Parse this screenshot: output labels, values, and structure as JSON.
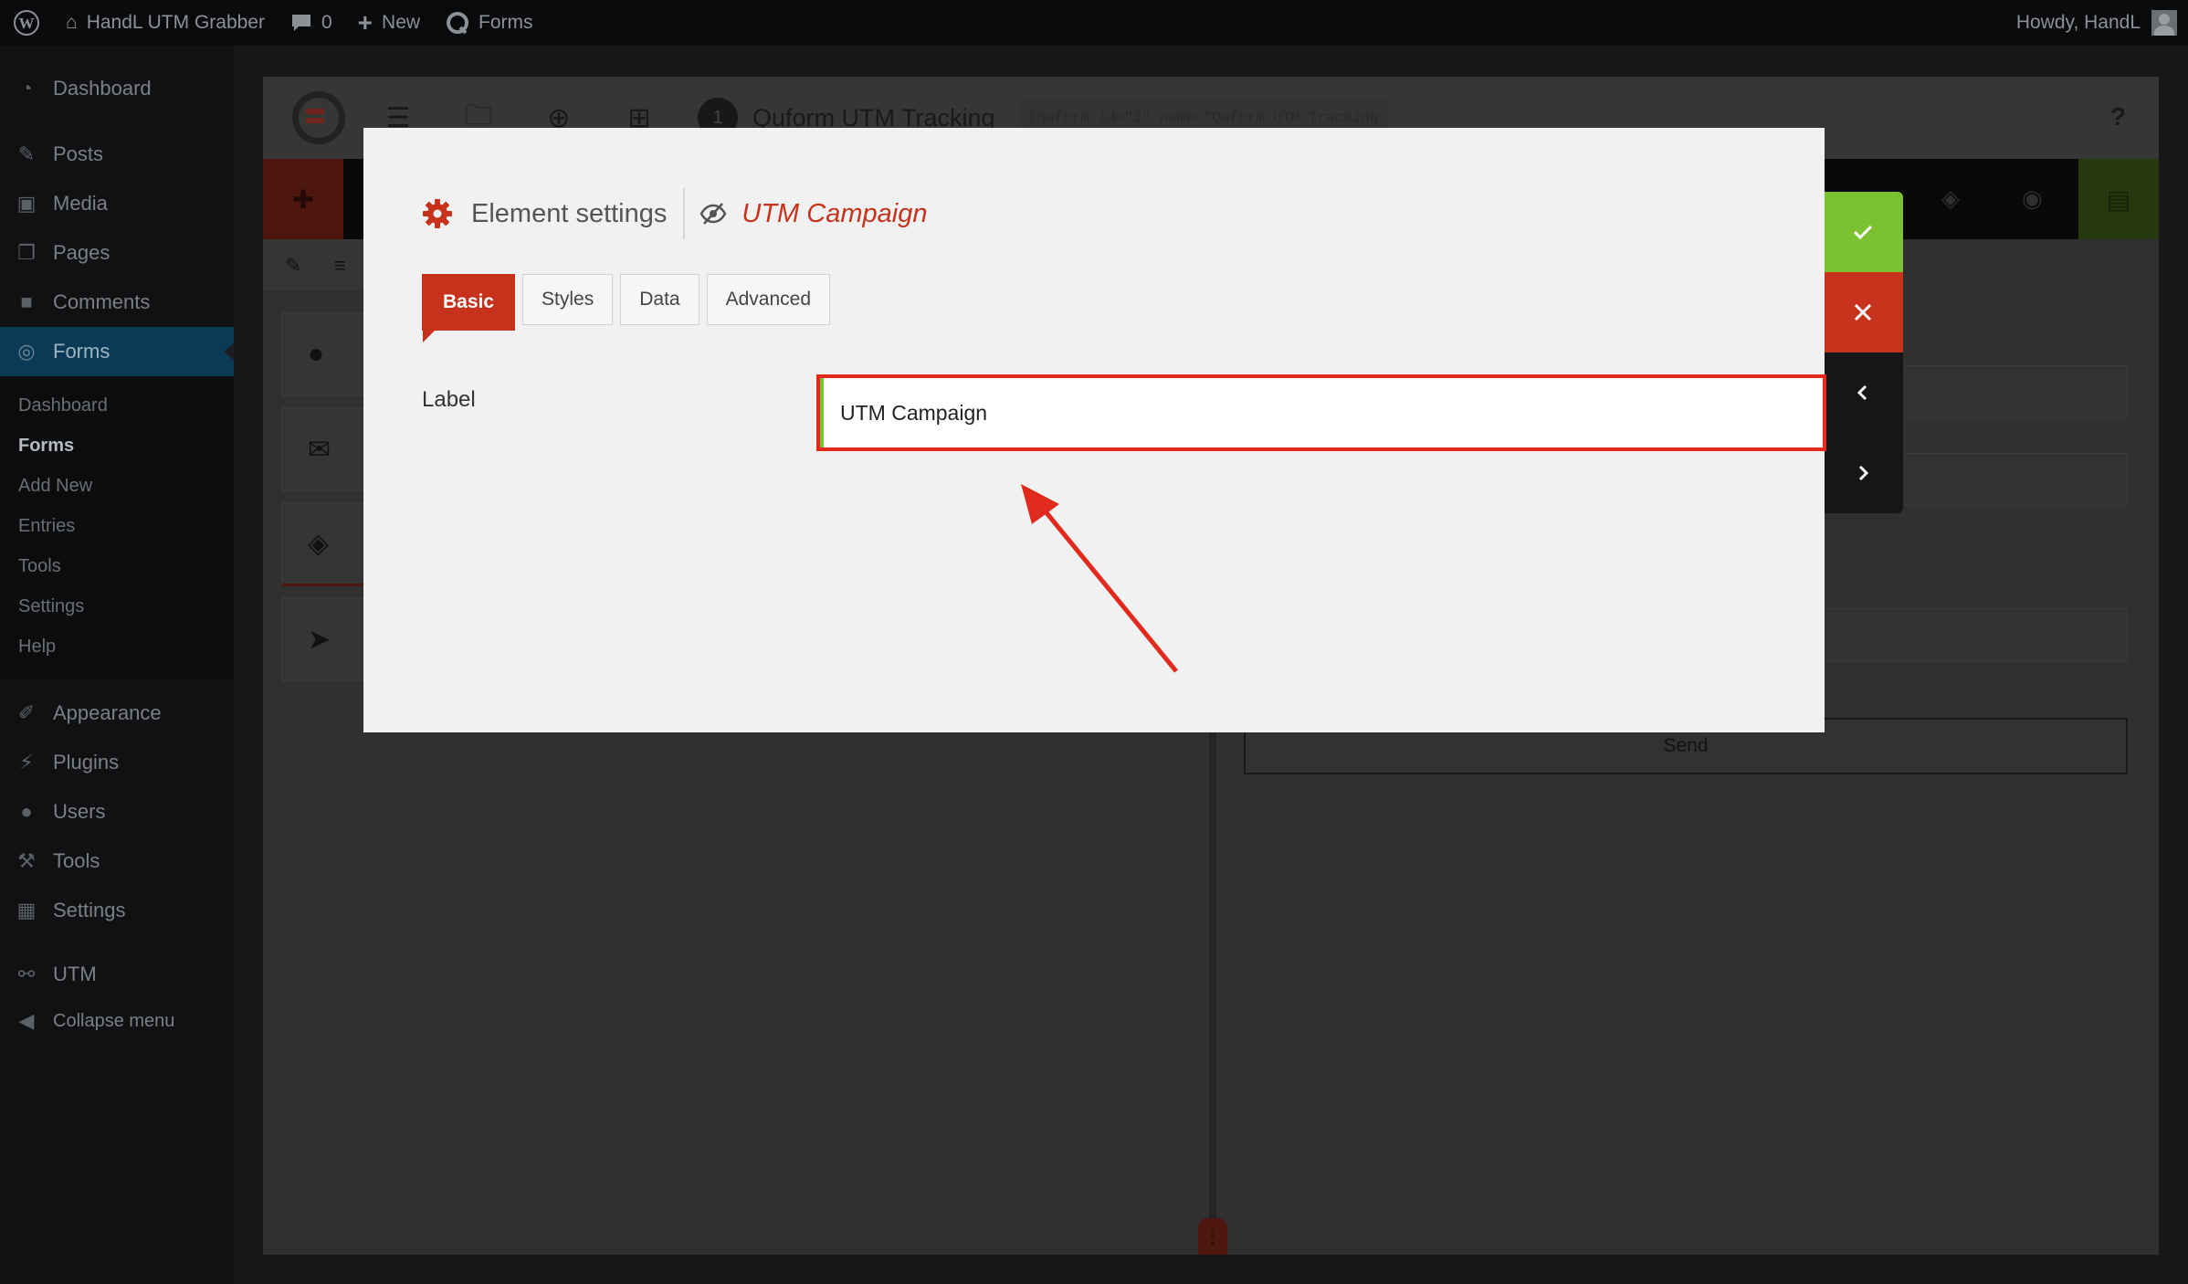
{
  "admin_bar": {
    "site_name": "HandL UTM Grabber",
    "comments_count": "0",
    "new_label": "New",
    "forms_label": "Forms",
    "greeting": "Howdy, HandL"
  },
  "sidebar": {
    "items": [
      {
        "label": "Dashboard",
        "icon": "dashboard-icon"
      },
      {
        "label": "Posts",
        "icon": "pin-icon"
      },
      {
        "label": "Media",
        "icon": "media-icon"
      },
      {
        "label": "Pages",
        "icon": "pages-icon"
      },
      {
        "label": "Comments",
        "icon": "comment-icon"
      },
      {
        "label": "Forms",
        "icon": "quform-icon",
        "current": true
      }
    ],
    "submenu": [
      "Dashboard",
      "Forms",
      "Add New",
      "Entries",
      "Tools",
      "Settings",
      "Help"
    ],
    "submenu_active": "Forms",
    "items_after": [
      {
        "label": "Appearance",
        "icon": "brush-icon"
      },
      {
        "label": "Plugins",
        "icon": "plugin-icon"
      },
      {
        "label": "Users",
        "icon": "user-icon"
      },
      {
        "label": "Tools",
        "icon": "wrench-icon"
      },
      {
        "label": "Settings",
        "icon": "settings-icon"
      },
      {
        "label": "UTM",
        "icon": "utm-icon"
      }
    ],
    "collapse_label": "Collapse menu"
  },
  "builder": {
    "form_number": "1",
    "form_name": "Quform UTM Tracking",
    "shortcode": "[quform id=\"1\" name=\"Quform UTM Tracking",
    "help": "?",
    "send_label": "Send"
  },
  "modal": {
    "title": "Element settings",
    "element_name": "UTM Campaign",
    "tabs": [
      "Basic",
      "Styles",
      "Data",
      "Advanced"
    ],
    "active_tab": "Basic",
    "label_field": {
      "label": "Label",
      "value": "UTM Campaign"
    }
  },
  "colors": {
    "accent_red": "#c6321c",
    "accent_green": "#7cc132",
    "wp_blue": "#0b3a57"
  }
}
